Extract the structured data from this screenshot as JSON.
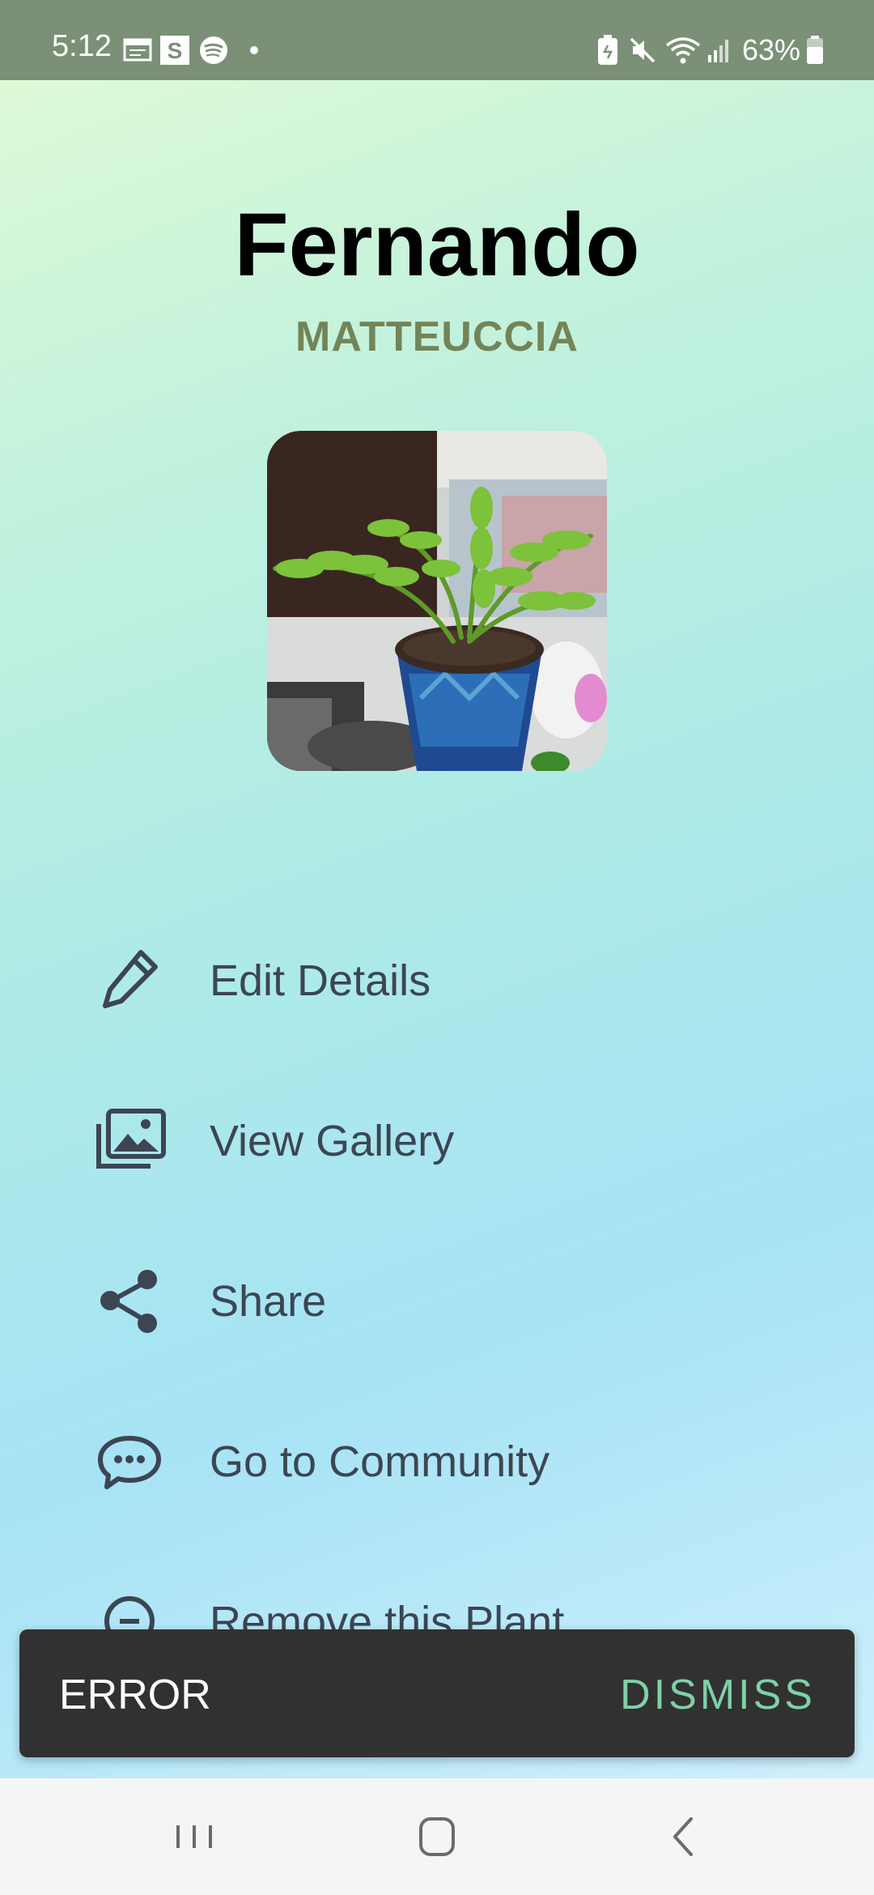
{
  "status_bar": {
    "time": "5:12",
    "battery_percent": "63%",
    "icons": [
      "calendar-icon",
      "s-app-icon",
      "spotify-icon",
      "dot-icon",
      "saver-icon",
      "mute-icon",
      "wifi-icon",
      "signal-icon",
      "battery-icon"
    ]
  },
  "plant": {
    "name": "Fernando",
    "species": "MATTEUCCIA",
    "photo_icon": "plant-photo"
  },
  "menu": {
    "items": [
      {
        "label": "Edit Details",
        "icon": "pencil-icon"
      },
      {
        "label": "View Gallery",
        "icon": "gallery-icon"
      },
      {
        "label": "Share",
        "icon": "share-icon"
      },
      {
        "label": "Go to Community",
        "icon": "chat-icon"
      },
      {
        "label": "Remove this Plant",
        "icon": "minus-circle-icon"
      }
    ]
  },
  "snackbar": {
    "message": "ERROR",
    "action": "DISMISS"
  },
  "navigation": {
    "buttons": [
      "recents-icon",
      "home-icon",
      "back-icon"
    ]
  },
  "colors": {
    "status_bar": "#7b9077",
    "species_text": "#738457",
    "menu_text": "#3d4553",
    "snackbar_bg": "#313131",
    "snackbar_action": "#7fd0a7"
  }
}
